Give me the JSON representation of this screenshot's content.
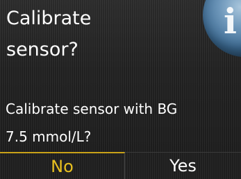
{
  "dialog": {
    "title_line1": "Calibrate",
    "title_line2": "sensor?",
    "message_line1": "Calibrate sensor with BG",
    "message_line2": "7.5 mmol/L?",
    "icon": "info-icon",
    "info_glyph": "i"
  },
  "buttons": {
    "no_label": "No",
    "yes_label": "Yes",
    "selected": "No",
    "selected_color": "#e8c020"
  }
}
